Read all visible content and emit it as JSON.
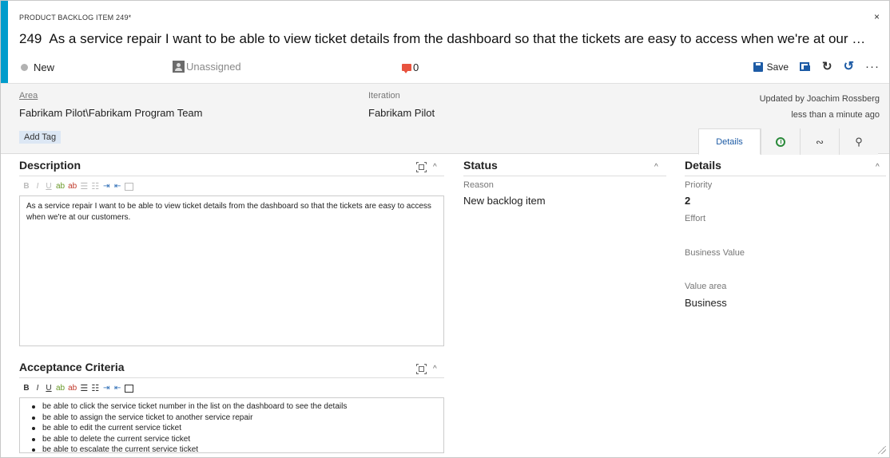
{
  "header": {
    "work_item_type": "PRODUCT BACKLOG ITEM 249*",
    "close_glyph": "×",
    "id": "249",
    "title": "As a service repair I want to be able to view ticket details from the dashboard so that the tickets are easy to access when we're at our …",
    "state": "New",
    "assigned_to": "Unassigned",
    "comment_count": "0",
    "accent_color": "#009ccc"
  },
  "toolbar": {
    "save_label": "Save",
    "icons": [
      "save-icon",
      "copy-icon",
      "refresh-icon",
      "undo-icon",
      "more-icon"
    ],
    "refresh_glyph": "↻",
    "undo_glyph": "↺",
    "more_glyph": "···"
  },
  "fields": {
    "area_label": "Area",
    "area_value": "Fabrikam Pilot\\Fabrikam Program Team",
    "iteration_label": "Iteration",
    "iteration_value": "Fabrikam Pilot",
    "updated_by": "Updated by Joachim Rossberg",
    "updated_when": "less than a minute ago",
    "add_tag_label": "Add Tag"
  },
  "tabs": {
    "details_label": "Details",
    "links_glyph": "∾",
    "attach_glyph": "⚲",
    "icons": [
      "history-icon",
      "links-icon",
      "attachment-icon"
    ]
  },
  "description": {
    "heading": "Description",
    "text": "As a service repair I want to be able to view ticket details from the dashboard so that the tickets are easy to access when we're at our customers."
  },
  "rte_toolbar": {
    "bold": "B",
    "italic": "I",
    "underline": "U",
    "highlight": "ab",
    "font_color": "ab",
    "bullets": "☰",
    "numbered": "☷",
    "indent": "⇥",
    "outdent": "⇤"
  },
  "acceptance": {
    "heading": "Acceptance Criteria",
    "items": [
      "be able to click the service ticket number in the list on the dashboard to see the details",
      "be able to assign the service ticket to another service repair",
      "be able to edit the current service ticket",
      "be able to delete the current service ticket",
      "be able to escalate the current service ticket"
    ]
  },
  "status": {
    "heading": "Status",
    "reason_label": "Reason",
    "reason_value": "New backlog item"
  },
  "details": {
    "heading": "Details",
    "priority_label": "Priority",
    "priority_value": "2",
    "effort_label": "Effort",
    "effort_value": "",
    "business_value_label": "Business Value",
    "business_value_value": "",
    "value_area_label": "Value area",
    "value_area_value": "Business"
  },
  "ui": {
    "caret_up": "^"
  }
}
